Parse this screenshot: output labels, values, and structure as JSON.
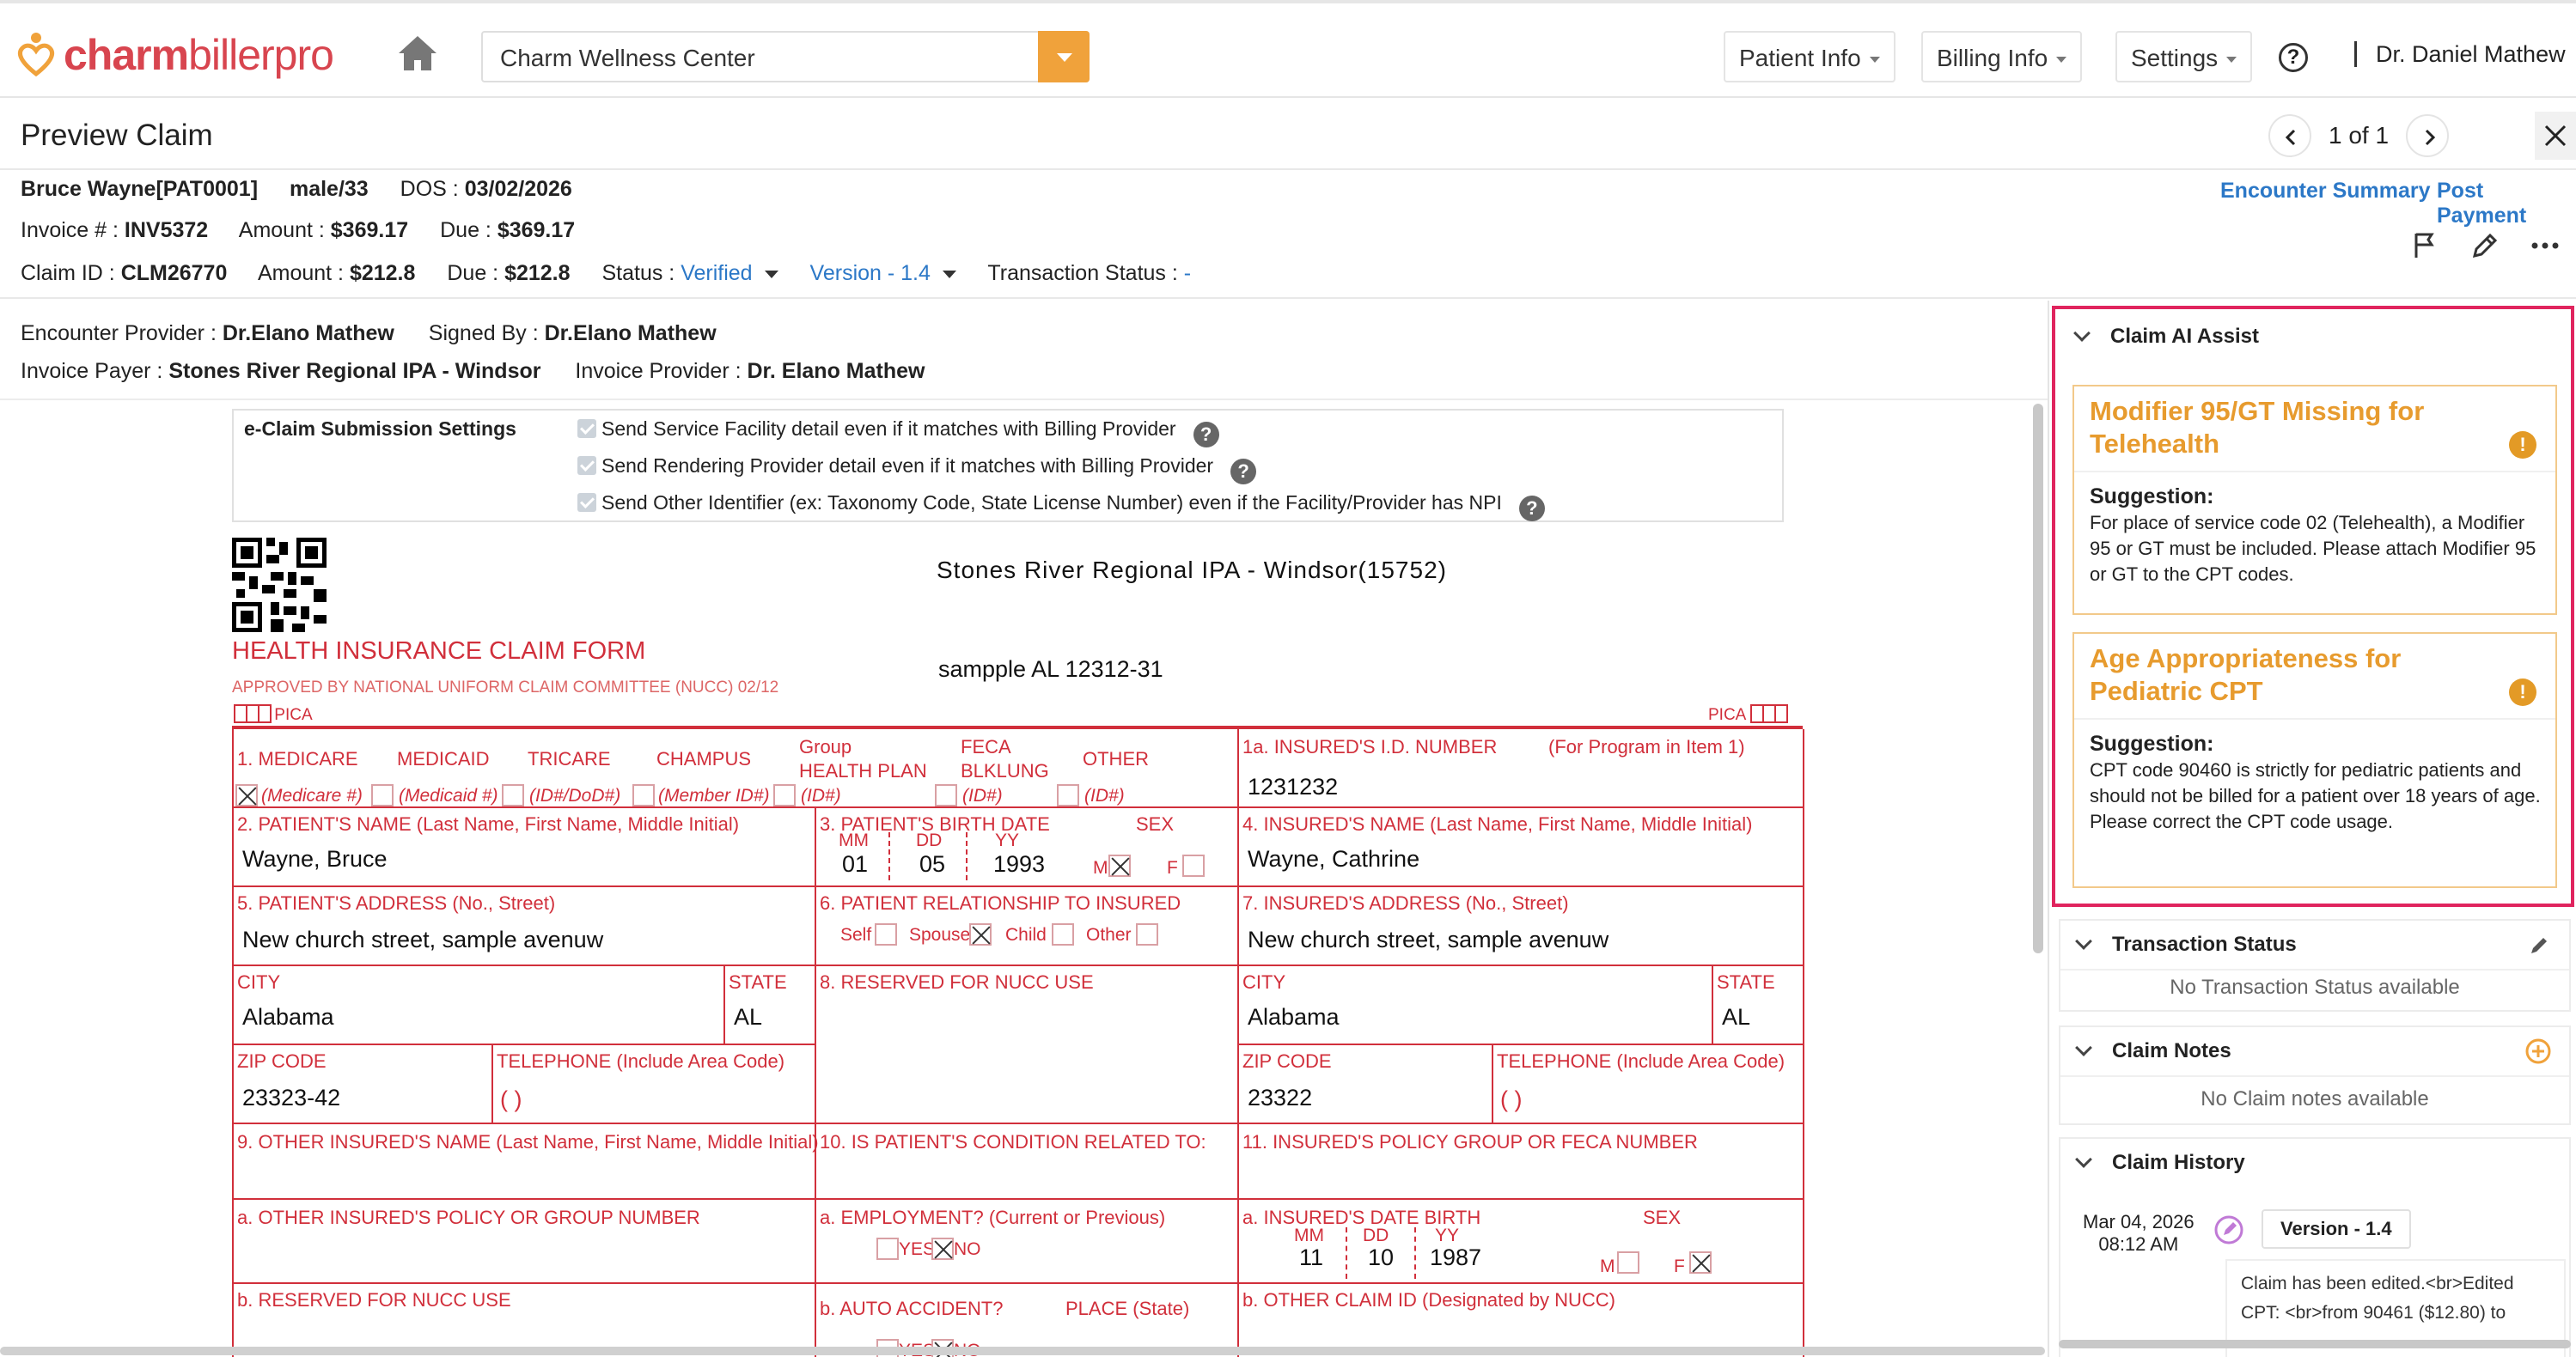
{
  "app": {
    "logo_part1": "charm",
    "logo_part2": "billerpro",
    "location": "Charm Wellness Center",
    "nav": [
      "Patient Info",
      "Billing Info",
      "Settings"
    ],
    "help": "?",
    "user": "Dr. Daniel Mathew"
  },
  "page": {
    "title": "Preview Claim",
    "pager": "1 of 1"
  },
  "patient": {
    "name": "Bruce Wayne[PAT0001]",
    "gender_age": "male/33",
    "dos_label": "DOS : ",
    "dos": "03/02/2026",
    "invoice_label": "Invoice # : ",
    "invoice": "INV5372",
    "amount_label": "Amount : ",
    "amount": "$369.17",
    "due_label": "Due : ",
    "due": "$369.17",
    "claim_label": "Claim ID : ",
    "claim_id": "CLM26770",
    "claim_amount": "$212.8",
    "claim_due": "$212.8",
    "status_label": "Status : ",
    "status": "Verified",
    "version": "Version - 1.4",
    "txn_label": "Transaction Status : ",
    "txn": "-"
  },
  "links": {
    "encounter_summary": "Encounter Summary",
    "post_payment": "Post Payment"
  },
  "meta": {
    "enc_provider_label": "Encounter Provider : ",
    "enc_provider": "Dr.Elano Mathew",
    "signed_label": "Signed By : ",
    "signed": "Dr.Elano Mathew",
    "payer_label": "Invoice Payer : ",
    "payer": "Stones River Regional IPA - Windsor",
    "inv_provider_label": "Invoice Provider : ",
    "inv_provider": "Dr. Elano Mathew"
  },
  "settings": {
    "title": "e-Claim Submission Settings",
    "options": [
      "Send Service Facility detail even if it matches with Billing Provider",
      "Send Rendering Provider detail even if it matches with Billing Provider",
      "Send Other Identifier (ex: Taxonomy Code, State License Number) even if the Facility/Provider has NPI"
    ]
  },
  "form": {
    "payer_name": "Stones River Regional IPA - Windsor(15752)",
    "payer_addr": "sampple AL 12312-31",
    "title": "HEALTH INSURANCE CLAIM FORM",
    "subtitle": "APPROVED BY NATIONAL UNIFORM CLAIM COMMITTEE (NUCC) 02/12",
    "pica": "PICA",
    "f1_label": "1.  MEDICARE",
    "medicaid": "MEDICAID",
    "tricare": "TRICARE",
    "champus": "CHAMPUS",
    "group1": "Group",
    "group2": "HEALTH PLAN",
    "feca1": "FECA",
    "feca2": "BLKLUNG",
    "other": "OTHER",
    "medicare_id": "(Medicare #)",
    "medicaid_id": "(Medicaid #)",
    "dod_id": "(ID#/DoD#)",
    "member_id": "(Member ID#)",
    "id1": "(ID#)",
    "id2": "(ID#)",
    "id3": "(ID#)",
    "f1a_label": "1a. INSURED'S I.D. NUMBER",
    "f1a_note": "(For Program in Item 1)",
    "insured_id": "1231232",
    "f2_label": "2. PATIENT'S NAME (Last Name, First Name, Middle Initial)",
    "patient_name": "Wayne, Bruce",
    "f3_label": "3. PATIENT'S BIRTH DATE",
    "sex": "SEX",
    "mm": "MM",
    "dd": "DD",
    "yy": "YY",
    "birth_mm": "01",
    "birth_dd": "05",
    "birth_yy": "1993",
    "m": "M",
    "f": "F",
    "f4_label": "4. INSURED'S NAME (Last Name, First Name, Middle Initial)",
    "insured_name": "Wayne, Cathrine",
    "f5_label": "5. PATIENT'S ADDRESS (No., Street)",
    "patient_addr": "New church street, sample avenuw",
    "f6_label": "6. PATIENT RELATIONSHIP TO INSURED",
    "self": "Self",
    "spouse": "Spouse",
    "child": "Child",
    "other_rel": "Other",
    "f7_label": "7. INSURED'S ADDRESS (No., Street)",
    "insured_addr": "New church street, sample avenuw",
    "city_label": "CITY",
    "state_label": "STATE",
    "city": "Alabama",
    "state": "AL",
    "f8_label": "8. RESERVED FOR NUCC USE",
    "ins_city": "Alabama",
    "ins_state": "AL",
    "zip_label": "ZIP CODE",
    "tel_label": "TELEPHONE (Include Area Code)",
    "zip": "23323-42",
    "tel": "(        )",
    "ins_zip": "23322",
    "ins_tel": "(        )",
    "f9_label": "9. OTHER INSURED'S NAME (Last Name, First Name, Middle Initial)",
    "f10_label": "10. IS PATIENT'S CONDITION RELATED TO:",
    "f11_label": "11. INSURED'S POLICY GROUP OR FECA NUMBER",
    "f9a_label": "a. OTHER INSURED'S POLICY OR GROUP NUMBER",
    "f10a_label": "a. EMPLOYMENT? (Current or Previous)",
    "yes": "YES",
    "no": "NO",
    "f11a_label": "a. INSURED'S DATE BIRTH",
    "ins_mm": "11",
    "ins_dd": "10",
    "ins_yy": "1987",
    "f9b_label": "b. RESERVED FOR NUCC USE",
    "f10b_label": "b. AUTO ACCIDENT?",
    "place_state": "PLACE (State)",
    "f11b_label": "b. OTHER CLAIM ID (Designated by NUCC)"
  },
  "ai_assist": {
    "title": "Claim AI Assist",
    "cards": [
      {
        "title": "Modifier 95/GT Missing for Telehealth",
        "suggestion_label": "Suggestion:",
        "text": "For place of service code 02 (Telehealth), a Modifier 95 or GT must be included. Please attach Modifier 95 or GT to the CPT codes."
      },
      {
        "title": "Age Appropriateness for Pediatric CPT",
        "suggestion_label": "Suggestion:",
        "text": "CPT code 90460 is strictly for pediatric patients and should not be billed for a patient over 18 years of age. Please correct the CPT code usage."
      }
    ]
  },
  "transaction_status": {
    "title": "Transaction Status",
    "empty": "No Transaction Status available"
  },
  "claim_notes": {
    "title": "Claim Notes",
    "empty": "No Claim notes available"
  },
  "claim_history": {
    "title": "Claim History",
    "date": "Mar 04, 2026",
    "time": "08:12 AM",
    "version": "Version - 1.4",
    "entry_line1": "Claim has been edited.<br>Edited",
    "entry_line2": "CPT: <br>from 90461 ($12.80) to"
  },
  "colors": {
    "form_red": "#d12f3b",
    "link_blue": "#2c78c7",
    "accent_orange": "#f0a23b",
    "ai_highlight": "#e0245e"
  }
}
